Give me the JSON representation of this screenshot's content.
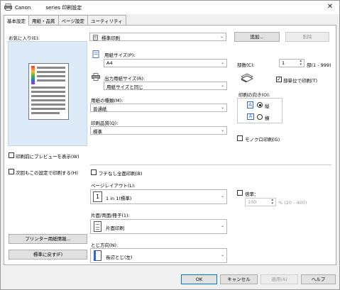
{
  "window": {
    "title": "Canon　　　series 印刷設定",
    "close_glyph": "✕"
  },
  "tabs": [
    {
      "label": "基本設定"
    },
    {
      "label": "用紙・品質"
    },
    {
      "label": "ページ設定"
    },
    {
      "label": "ユーティリティ"
    }
  ],
  "favorites": {
    "label": "お気に入り(E):",
    "value": "標準印刷",
    "add_label": "追加...",
    "delete_label": "削除"
  },
  "paper_size": {
    "label": "用紙サイズ(P):",
    "value": "A4"
  },
  "output_size": {
    "label": "出力用紙サイズ(R):",
    "value": "用紙サイズと同じ"
  },
  "media_type": {
    "label": "用紙の種類(M):",
    "value": "普通紙"
  },
  "print_quality": {
    "label": "印刷品質(Q):",
    "value": "標準"
  },
  "copies": {
    "label": "部数(C):",
    "value": "1",
    "range": "部(1 - 999)"
  },
  "collate": {
    "label": "部単位で印刷(T)",
    "checked": true
  },
  "orientation": {
    "label": "印刷の向き(O):",
    "portrait_label": "縦",
    "landscape_label": "横",
    "selected": "縦"
  },
  "grayscale": {
    "label": "モノクロ印刷(G)",
    "checked": false
  },
  "preview_before_print": {
    "label": "印刷前にプレビューを表示(W)",
    "checked": false
  },
  "use_next_time": {
    "label": "次回もこの設定で印刷する(H)",
    "checked": false
  },
  "borderless": {
    "label": "フチなし全面印刷(B)",
    "checked": false
  },
  "page_layout": {
    "label": "ページレイアウト(L):",
    "value": "1 in 1(標準)",
    "icon_glyph": "1"
  },
  "scaling": {
    "label": "倍率：",
    "value": "100",
    "range": "% (20 - 400)",
    "checked": false
  },
  "duplex": {
    "label": "片面/両面/冊子(1):",
    "value": "片面印刷"
  },
  "stapling": {
    "label": "とじ方向(N):",
    "value": "長辺とじ(左)"
  },
  "buttons": {
    "printer_info": "プリンター用紙情報...",
    "defaults": "標準に戻す(F)",
    "ok": "OK",
    "cancel": "キャンセル",
    "apply": "適用(A)",
    "help": "ヘルプ"
  },
  "icons": {
    "app": "printer-icon",
    "favorite": "document-icon",
    "paper": "paper-size-icon",
    "output": "printer-output-icon",
    "copies": "copies-icon",
    "portrait": "portrait-a-icon",
    "landscape": "landscape-a-icon"
  },
  "colors": {
    "accent": "#0078d7",
    "preview_bg": "#ddeaf7"
  }
}
